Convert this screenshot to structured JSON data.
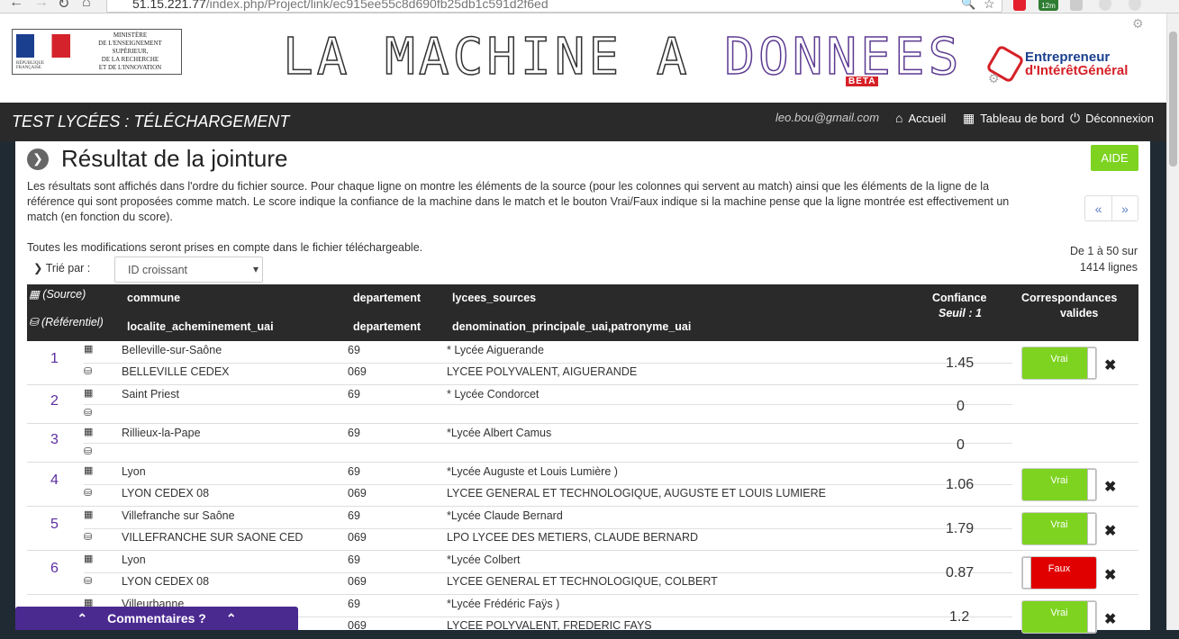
{
  "browser": {
    "url_host": "51.15.221.77",
    "url_path": "/index.php/Project/link/ec915ee55c8d690fb25db1c591d2f6ed",
    "ext_badge": "12m"
  },
  "header": {
    "ministere_lines": [
      "MINISTÈRE",
      "DE L'ENSEIGNEMENT SUPÉRIEUR,",
      "DE LA RECHERCHE",
      "ET DE L'INNOVATION"
    ],
    "republique": "RÉPUBLIQUE FRANÇAISE",
    "logo_part1": "LA MACHINE A ",
    "logo_part2": "DONNEES",
    "beta": "BETA",
    "eig_line1": "Entrepreneur",
    "eig_line2": "d'IntérêtGénéral"
  },
  "navbar": {
    "page_title": "TEST LYCÉES : TÉLÉCHARGEMENT",
    "email": "leo.bou@gmail.com",
    "accueil": "Accueil",
    "tableau": "Tableau de bord",
    "deconnexion": "Déconnexion"
  },
  "main": {
    "title": "Résultat de la jointure",
    "aide": "AIDE",
    "description": "Les résultats sont affichés dans l'ordre du fichier source. Pour chaque ligne on montre les éléments de la source (pour les colonnes qui servent au match) ainsi que les éléments de la ligne de la référence qui sont proposées comme match. Le score indique la confiance de la machine dans le match et le bouton Vrai/Faux indique si la machine pense que la ligne montrée est effectivement un match (en fonction du score).",
    "note": "Toutes les modifications seront prises en compte dans le fichier téléchargeable.",
    "range_line1": "De 1 à 50 sur",
    "range_line2": "1414 lignes",
    "pager_prev": "«",
    "pager_next": "»",
    "sort_label": "Trié par :",
    "sort_value": "ID croissant"
  },
  "table": {
    "source_label": "(Source)",
    "ref_label": "(Référentiel)",
    "src_cols": [
      "commune",
      "departement",
      "lycees_sources"
    ],
    "ref_cols": [
      "localite_acheminement_uai",
      "departement",
      "denomination_principale_uai,patronyme_uai"
    ],
    "confiance": "Confiance",
    "seuil": "Seuil : 1",
    "corr1": "Correspondances",
    "corr2": "valides",
    "rows": [
      {
        "id": "1",
        "src": [
          "Belleville-sur-Saône",
          "69",
          "* Lycée Aiguerande"
        ],
        "ref": [
          "BELLEVILLE CEDEX",
          "069",
          "LYCEE POLYVALENT, AIGUERANDE"
        ],
        "score": "1.45",
        "match": "Vrai"
      },
      {
        "id": "2",
        "src": [
          "Saint Priest",
          "69",
          "* Lycée Condorcet"
        ],
        "ref": [
          "",
          "",
          ""
        ],
        "score": "0",
        "match": ""
      },
      {
        "id": "3",
        "src": [
          "Rillieux-la-Pape",
          "69",
          "*Lycée Albert Camus"
        ],
        "ref": [
          "",
          "",
          ""
        ],
        "score": "0",
        "match": ""
      },
      {
        "id": "4",
        "src": [
          "Lyon",
          "69",
          "*Lycée Auguste et Louis Lumière )"
        ],
        "ref": [
          "LYON CEDEX 08",
          "069",
          "LYCEE GENERAL ET TECHNOLOGIQUE, AUGUSTE ET LOUIS LUMIERE"
        ],
        "score": "1.06",
        "match": "Vrai"
      },
      {
        "id": "5",
        "src": [
          "Villefranche sur Saône",
          "69",
          "*Lycée Claude Bernard"
        ],
        "ref": [
          "VILLEFRANCHE SUR SAONE CED",
          "069",
          "LPO LYCEE DES METIERS, CLAUDE BERNARD"
        ],
        "score": "1.79",
        "match": "Vrai"
      },
      {
        "id": "6",
        "src": [
          "Lyon",
          "69",
          "*Lycée Colbert"
        ],
        "ref": [
          "LYON CEDEX 08",
          "069",
          "LYCEE GENERAL ET TECHNOLOGIQUE, COLBERT"
        ],
        "score": "0.87",
        "match": "Faux"
      },
      {
        "id": "",
        "src": [
          "Villeurbanne",
          "69",
          "*Lycée Frédéric Faÿs )"
        ],
        "ref": [
          "",
          "069",
          "LYCEE POLYVALENT, FREDERIC FAYS"
        ],
        "score": "1.2",
        "match": "Vrai"
      }
    ]
  },
  "footer": {
    "comments": "Commentaires ?"
  },
  "colors": {
    "vrai": "#7ed321",
    "faux": "#e10000",
    "id_purple": "#5b2da0",
    "dark": "#2a2a2a"
  }
}
